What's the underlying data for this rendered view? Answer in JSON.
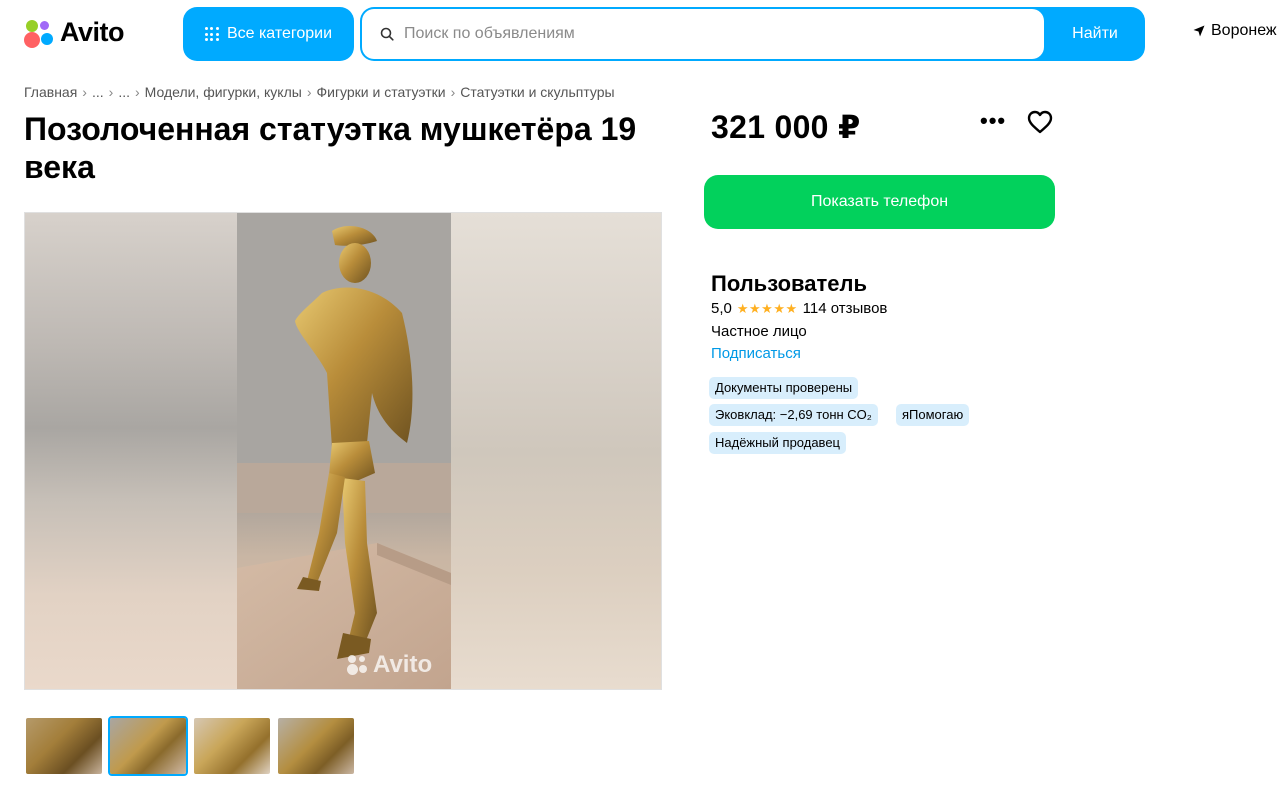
{
  "header": {
    "logo_text": "Avito",
    "all_categories_label": "Все категории",
    "search_placeholder": "Поиск по объявлениям",
    "search_button_label": "Найти",
    "location": "Воронеж"
  },
  "breadcrumbs": [
    "Главная",
    "...",
    "...",
    "Модели, фигурки, куклы",
    "Фигурки и статуэтки",
    "Статуэтки и скульптуры"
  ],
  "listing": {
    "title": "Позолоченная статуэтка мушкетёра 19 века",
    "price": "321 000 ₽",
    "more_label": "•••",
    "watermark": "Avito",
    "thumbnails_count": 4,
    "active_thumbnail": 2
  },
  "actions": {
    "show_phone_label": "Показать телефон"
  },
  "seller": {
    "name": "Пользователь",
    "rating": "5,0",
    "stars": "★★★★★",
    "reviews": "114 отзывов",
    "type": "Частное лицо",
    "subscribe_label": "Подписаться",
    "badges": [
      "Документы проверены",
      "Эковклад: −2,69 тонн CO₂",
      "яПомогаю",
      "Надёжный продавец"
    ]
  },
  "colors": {
    "accent_blue": "#00aaff",
    "green": "#02d15c",
    "badge_bg": "#d8eefc",
    "star": "#ffb021",
    "link": "#0099e6"
  }
}
